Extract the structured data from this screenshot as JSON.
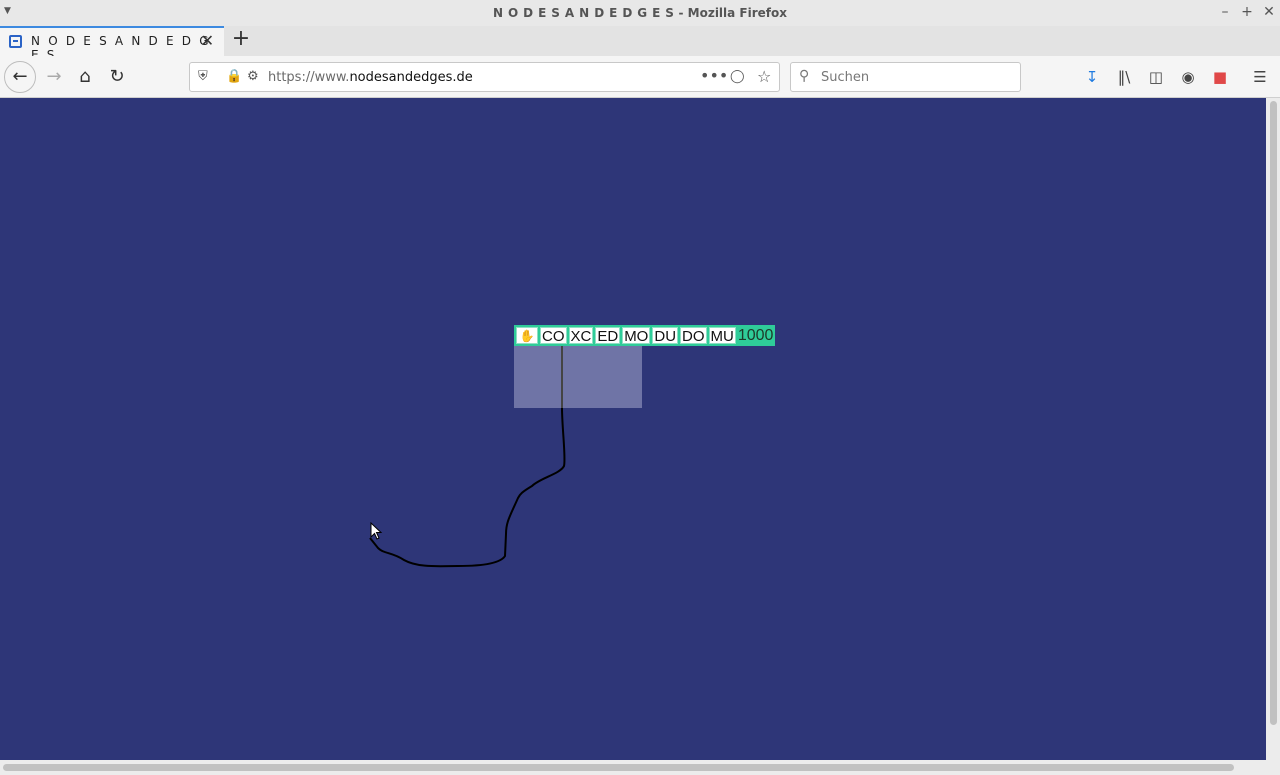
{
  "window": {
    "title_site": "N O D E S A N D E D G E S",
    "title_app": " - Mozilla Firefox"
  },
  "tab": {
    "label": "N O D E S A N D E D G E S"
  },
  "navbar": {
    "url_prefix": "https://www.",
    "url_domain": "nodesandedges.de",
    "search_placeholder": "Suchen"
  },
  "node": {
    "buttons": [
      "CO",
      "XC",
      "ED",
      "MO",
      "DU",
      "DO",
      "MU"
    ],
    "count": "1000"
  },
  "colors": {
    "canvas": "#2e3678",
    "node_toolbar": "#2fcc99",
    "node_body": "#6f74a6"
  }
}
